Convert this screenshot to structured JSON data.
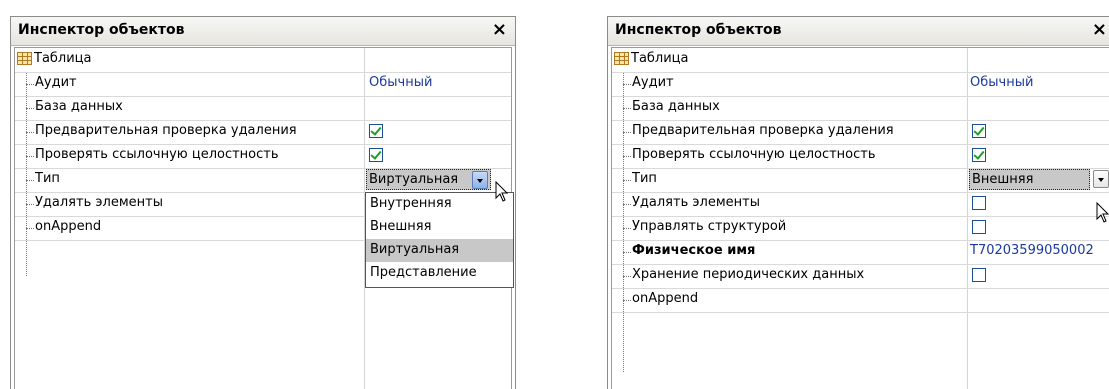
{
  "left_panel": {
    "title": "Инспектор объектов",
    "close_glyph": "×",
    "root": "Таблица",
    "rows": {
      "audit": {
        "name": "Аудит",
        "value": "Обычный"
      },
      "database": {
        "name": "База данных"
      },
      "pre_check_delete": {
        "name": "Предварительная проверка удаления",
        "checked": true
      },
      "check_ref_integrity": {
        "name": "Проверять ссылочную целостность",
        "checked": true
      },
      "type": {
        "name": "Тип",
        "value": "Виртуальная"
      },
      "delete_elements": {
        "name": "Удалять элементы"
      },
      "on_append": {
        "name": "onAppend"
      }
    },
    "dropdown_options": [
      "Внутренняя",
      "Внешняя",
      "Виртуальная",
      "Представление"
    ],
    "dropdown_selected": "Виртуальная"
  },
  "right_panel": {
    "title": "Инспектор объектов",
    "close_glyph": "×",
    "root": "Таблица",
    "rows": {
      "audit": {
        "name": "Аудит",
        "value": "Обычный"
      },
      "database": {
        "name": "База данных"
      },
      "pre_check_delete": {
        "name": "Предварительная проверка удаления",
        "checked": true
      },
      "check_ref_integrity": {
        "name": "Проверять ссылочную целостность",
        "checked": true
      },
      "type": {
        "name": "Тип",
        "value": "Внешняя"
      },
      "delete_elements": {
        "name": "Удалять элементы",
        "checked": false
      },
      "manage_structure": {
        "name": "Управлять структурой",
        "checked": false
      },
      "physical_name": {
        "name": "Физическое имя",
        "value": "T70203599050002"
      },
      "periodic_storage": {
        "name": "Хранение периодических данных",
        "checked": false
      },
      "on_append": {
        "name": "onAppend"
      }
    }
  },
  "colors": {
    "value_text": "#1a3a9c",
    "checkmark": "#1e9e28",
    "checkbox_border": "#1c4e94",
    "selection": "#c8c8c8"
  },
  "icons": {
    "table": "table-icon",
    "close": "close-icon",
    "dropdown": "chevron-down-icon",
    "cursor": "mouse-cursor-icon"
  }
}
